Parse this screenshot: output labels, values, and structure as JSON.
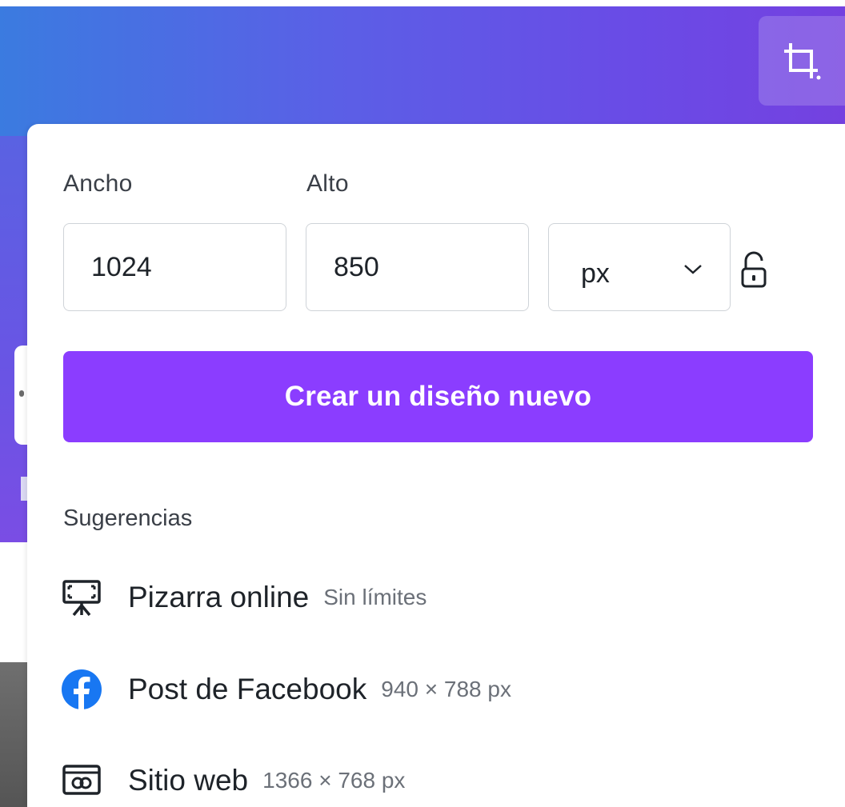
{
  "toolbar": {
    "crop_icon": "crop-icon"
  },
  "panel": {
    "width_label": "Ancho",
    "height_label": "Alto",
    "width_value": "1024",
    "height_value": "850",
    "unit_value": "px",
    "lock_icon": "unlocked-padlock-icon",
    "create_button_label": "Crear un diseño nuevo",
    "suggestions_title": "Sugerencias",
    "suggestions": [
      {
        "name": "Pizarra online",
        "meta": "Sin límites",
        "icon": "whiteboard-icon"
      },
      {
        "name": "Post de Facebook",
        "meta": "940 × 788 px",
        "icon": "facebook-icon"
      },
      {
        "name": "Sitio web",
        "meta": "1366 × 768 px",
        "icon": "website-icon"
      }
    ]
  },
  "colors": {
    "accent": "#8b3dff",
    "banner_start": "#3b7be0",
    "banner_end": "#7441e0",
    "facebook": "#1877f2"
  }
}
